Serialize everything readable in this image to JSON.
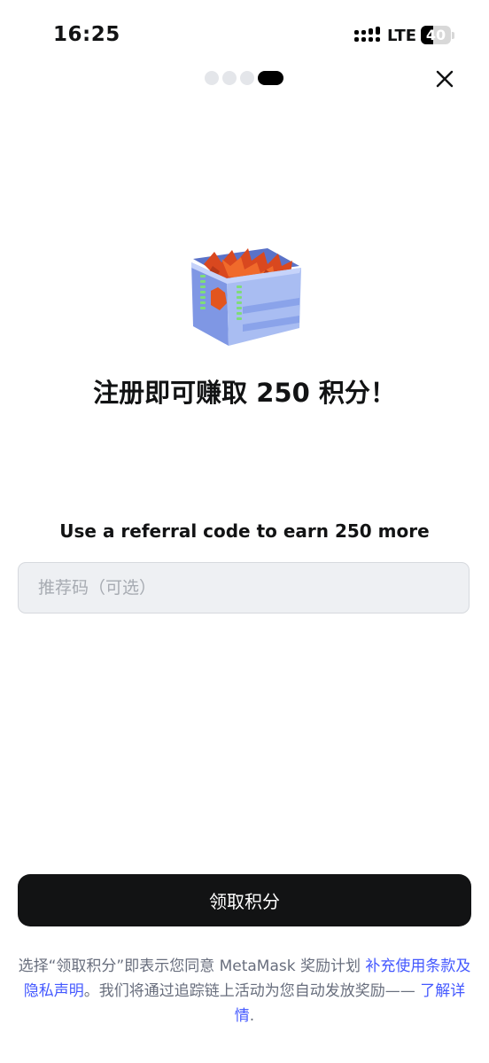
{
  "status_bar": {
    "time": "16:25",
    "network": "LTE",
    "battery_level": "40",
    "battery_fraction": 0.4
  },
  "pager": {
    "total": 4,
    "active_index": 3
  },
  "icons": {
    "close": "close-icon",
    "illustration": "points-crate-illustration"
  },
  "headline": "注册即可赚取 250 积分！",
  "referral": {
    "label": "Use a referral code to earn 250 more",
    "placeholder": "推荐码（可选）",
    "value": ""
  },
  "claim_button_label": "领取积分",
  "legal": {
    "prefix": "选择“领取积分”即表示您同意 MetaMask 奖励计划 ",
    "terms_link": "补充使用条款及隐私声明",
    "middle": "。我们将通过追踪链上活动为您自动发放奖励—— ",
    "details_link": "了解详情",
    "suffix": "."
  },
  "colors": {
    "primary_text": "#121314",
    "muted_text": "#686e7d",
    "link": "#4459ff",
    "button_bg": "#121314",
    "input_bg": "#eef0f3"
  }
}
